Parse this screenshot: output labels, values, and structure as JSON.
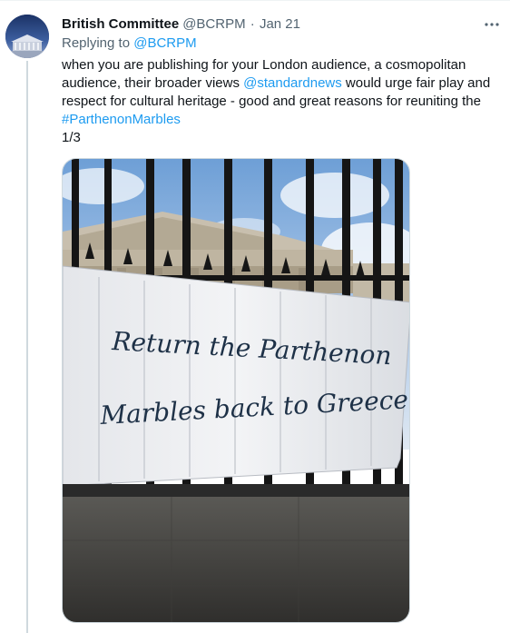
{
  "tweet": {
    "display_name": "British Committee",
    "handle": "@BCRPM",
    "separator": "·",
    "date": "Jan 21",
    "replying_to_prefix": "Replying to",
    "replying_to_handle": "@BCRPM",
    "text_part1": "when you are publishing for your London audience, a cosmopolitan audience, their broader views",
    "mention": "@standardnews",
    "text_part2": "would urge fair play and respect for cultural heritage - good and great reasons for reuniting the",
    "hashtag": "#ParthenonMarbles",
    "thread_count": "1/3",
    "more_icon": "more-horizontal-icon",
    "link_color": "#1d9bf0",
    "secondary_color": "#536471"
  },
  "media": {
    "banner_line1": "Return the Parthenon",
    "banner_line2": "Marbles back to Greece"
  }
}
